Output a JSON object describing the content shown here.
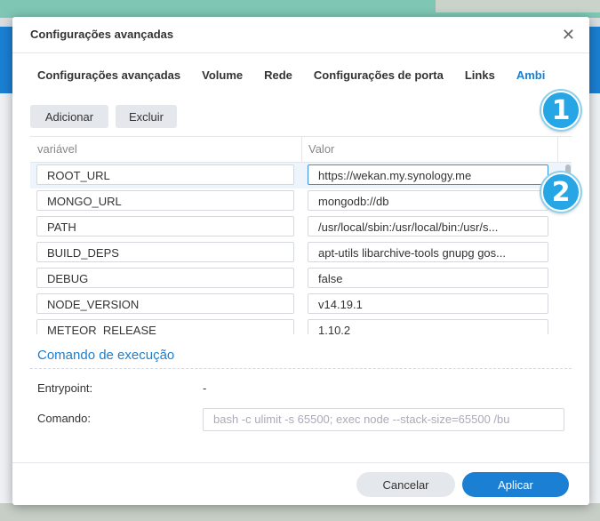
{
  "dialog": {
    "title": "Configurações avançadas",
    "close_glyph": "✕"
  },
  "tabs": [
    {
      "label": "Configurações avançadas",
      "active": false
    },
    {
      "label": "Volume",
      "active": false
    },
    {
      "label": "Rede",
      "active": false
    },
    {
      "label": "Configurações de porta",
      "active": false
    },
    {
      "label": "Links",
      "active": false
    },
    {
      "label": "Ambi",
      "active": true
    }
  ],
  "toolbar": {
    "add_label": "Adicionar",
    "delete_label": "Excluir"
  },
  "table": {
    "headers": {
      "variable": "variável",
      "value": "Valor"
    },
    "rows": [
      {
        "variable": "ROOT_URL",
        "value": "https://wekan.my.synology.me"
      },
      {
        "variable": "MONGO_URL",
        "value": "mongodb://db"
      },
      {
        "variable": "PATH",
        "value": "/usr/local/sbin:/usr/local/bin:/usr/s..."
      },
      {
        "variable": "BUILD_DEPS",
        "value": "apt-utils libarchive-tools gnupg gos..."
      },
      {
        "variable": "DEBUG",
        "value": "false"
      },
      {
        "variable": "NODE_VERSION",
        "value": "v14.19.1"
      },
      {
        "variable": "METEOR_RELEASE",
        "value": "1.10.2"
      }
    ]
  },
  "execution": {
    "section_title": "Comando de execução",
    "entrypoint_label": "Entrypoint:",
    "entrypoint_value": "-",
    "command_label": "Comando:",
    "command_placeholder": "bash -c ulimit -s 65500; exec node --stack-size=65500 /bu"
  },
  "footer": {
    "cancel_label": "Cancelar",
    "apply_label": "Aplicar"
  },
  "badges": {
    "one": "1",
    "two": "2"
  },
  "colors": {
    "accent": "#1b7fd3",
    "badge": "#27a6e6"
  }
}
